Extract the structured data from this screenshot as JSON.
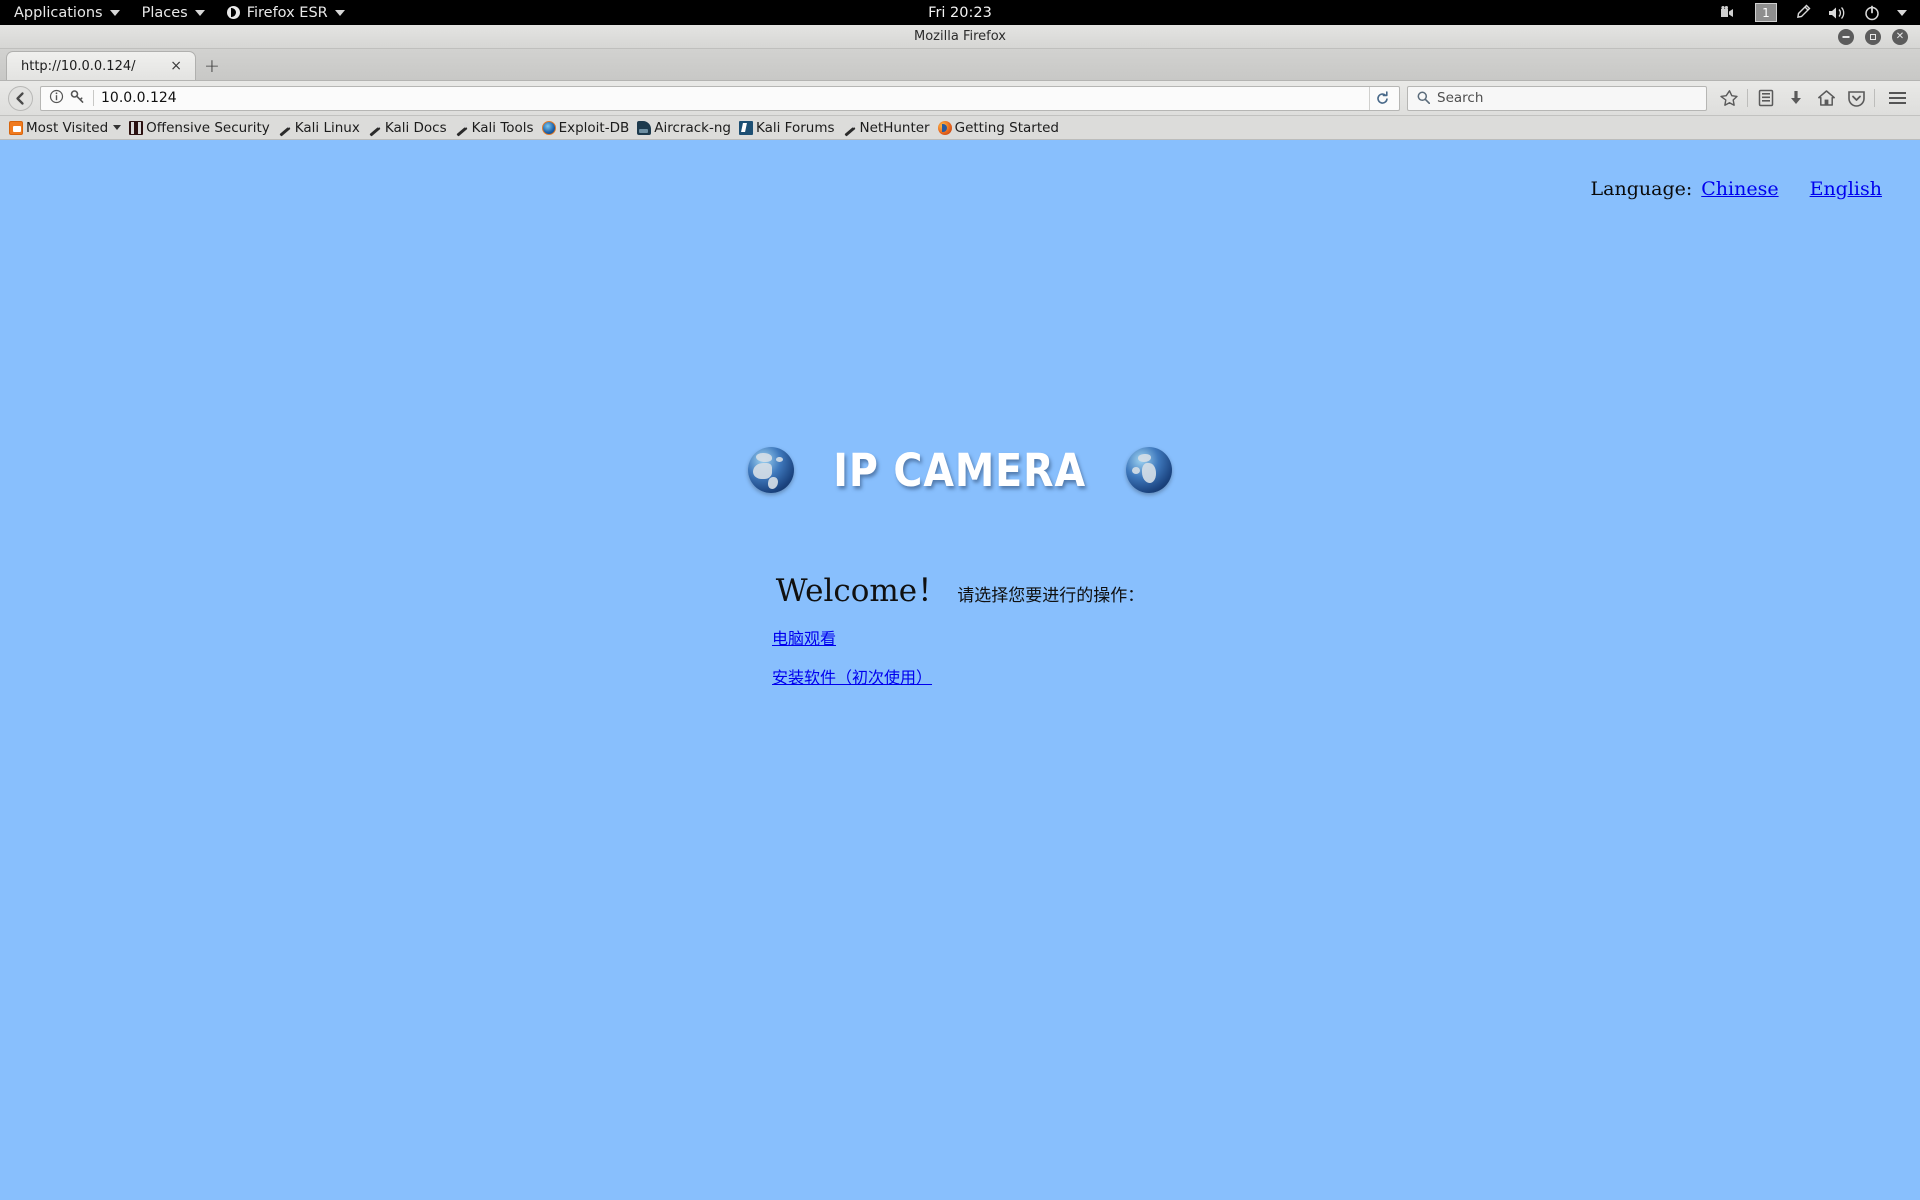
{
  "desktop_panel": {
    "menus": [
      {
        "label": "Applications",
        "icon": "none",
        "caret": true
      },
      {
        "label": "Places",
        "icon": "none",
        "caret": true
      },
      {
        "label": "Firefox ESR",
        "icon": "firefox-icon",
        "caret": true
      }
    ],
    "clock": "Fri 20:23",
    "tray": {
      "video_icon": "video-camera-icon",
      "workspace": "1",
      "pen_icon": "pen-icon",
      "volume_icon": "speaker-icon",
      "power_icon": "power-icon",
      "menu_caret": "chevron-down-icon"
    }
  },
  "browser": {
    "title": "Mozilla Firefox",
    "window_buttons": {
      "minimize": "–",
      "maximize": "□",
      "close": "×"
    },
    "tabs": [
      {
        "label": "http://10.0.0.124/",
        "close": "×"
      }
    ],
    "new_tab_label": "+",
    "url_value": "10.0.0.124",
    "search_placeholder": "Search",
    "nav_icons": [
      "bookmark-star-icon",
      "library-icon",
      "download-icon",
      "home-icon",
      "pocket-icon",
      "hamburger-menu-icon"
    ],
    "bookmarks": [
      {
        "label": "Most Visited",
        "icon": "most-visited-icon",
        "caret": true
      },
      {
        "label": "Offensive Security",
        "icon": "offensive-security-icon",
        "caret": false
      },
      {
        "label": "Kali Linux",
        "icon": "kali-dragon-icon",
        "caret": false
      },
      {
        "label": "Kali Docs",
        "icon": "kali-dragon-icon",
        "caret": false
      },
      {
        "label": "Kali Tools",
        "icon": "kali-dragon-icon",
        "caret": false
      },
      {
        "label": "Exploit-DB",
        "icon": "exploit-db-icon",
        "caret": false
      },
      {
        "label": "Aircrack-ng",
        "icon": "aircrack-ng-icon",
        "caret": false
      },
      {
        "label": "Kali Forums",
        "icon": "kali-forums-icon",
        "caret": false
      },
      {
        "label": "NetHunter",
        "icon": "kali-dragon-icon",
        "caret": false
      },
      {
        "label": "Getting Started",
        "icon": "firefox-icon",
        "caret": false
      }
    ]
  },
  "page": {
    "background_color": "#88bffd",
    "link_color": "#0000ee",
    "language": {
      "label": "Language:",
      "options": [
        {
          "label": "Chinese"
        },
        {
          "label": "English"
        }
      ]
    },
    "logo": {
      "text": "IP CAMERA",
      "left_globe": "globe-icon",
      "right_globe": "globe-icon"
    },
    "welcome": {
      "english": "Welcome！",
      "chinese": "请选择您要进行的操作："
    },
    "actions": [
      {
        "label": "电脑观看"
      },
      {
        "label": "安装软件（初次使用）"
      }
    ]
  }
}
